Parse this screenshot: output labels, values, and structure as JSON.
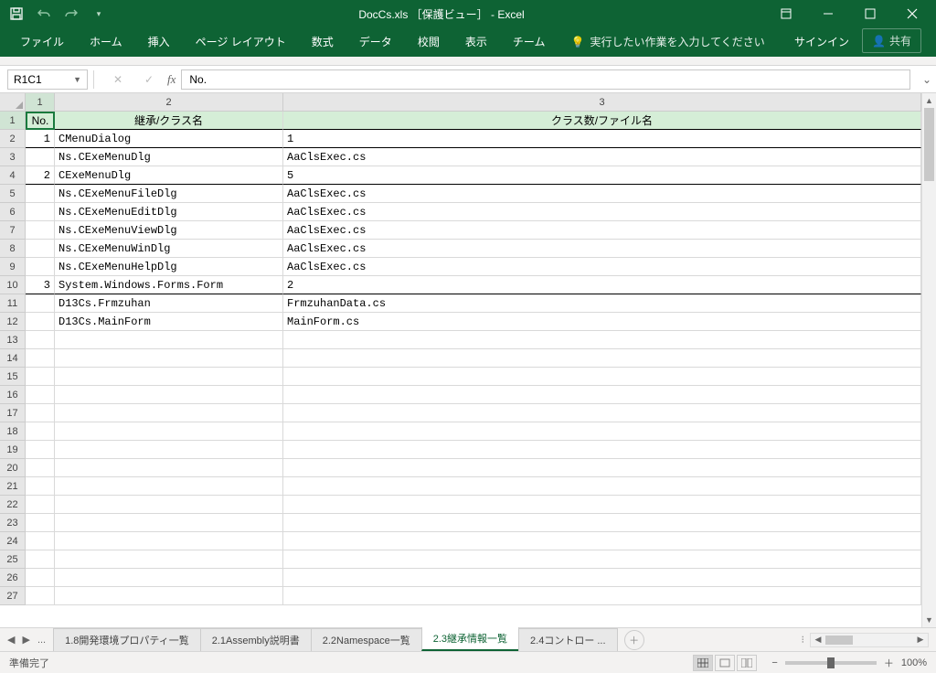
{
  "title": "DocCs.xls ［保護ビュー］ - Excel",
  "qat": {
    "save": "save-icon",
    "undo": "undo-icon",
    "redo": "redo-icon"
  },
  "win": {
    "restore": "restore-icon"
  },
  "tabs": [
    "ファイル",
    "ホーム",
    "挿入",
    "ページ レイアウト",
    "数式",
    "データ",
    "校閲",
    "表示",
    "チーム"
  ],
  "tellme": "実行したい作業を入力してください",
  "signin": "サインイン",
  "share": "共有",
  "namebox": "R1C1",
  "formula": "No.",
  "columns": [
    "1",
    "2",
    "3"
  ],
  "headers": {
    "no": "No.",
    "c2": "継承/クラス名",
    "c3": "クラス数/ファイル名"
  },
  "rows": [
    {
      "r": 2,
      "no": "1",
      "c2": "CMenuDialog",
      "c3": "1",
      "group": true
    },
    {
      "r": 3,
      "no": "",
      "c2": "Ns.CExeMenuDlg",
      "c3": "AaClsExec.cs"
    },
    {
      "r": 4,
      "no": "2",
      "c2": "CExeMenuDlg",
      "c3": "5",
      "group": true
    },
    {
      "r": 5,
      "no": "",
      "c2": "Ns.CExeMenuFileDlg",
      "c3": "AaClsExec.cs"
    },
    {
      "r": 6,
      "no": "",
      "c2": "Ns.CExeMenuEditDlg",
      "c3": "AaClsExec.cs"
    },
    {
      "r": 7,
      "no": "",
      "c2": "Ns.CExeMenuViewDlg",
      "c3": "AaClsExec.cs"
    },
    {
      "r": 8,
      "no": "",
      "c2": "Ns.CExeMenuWinDlg",
      "c3": "AaClsExec.cs"
    },
    {
      "r": 9,
      "no": "",
      "c2": "Ns.CExeMenuHelpDlg",
      "c3": "AaClsExec.cs"
    },
    {
      "r": 10,
      "no": "3",
      "c2": "System.Windows.Forms.Form",
      "c3": "2",
      "group": true
    },
    {
      "r": 11,
      "no": "",
      "c2": "D13Cs.Frmzuhan",
      "c3": "FrmzuhanData.cs"
    },
    {
      "r": 12,
      "no": "",
      "c2": "D13Cs.MainForm",
      "c3": "MainForm.cs"
    }
  ],
  "empty_rows": [
    13,
    14,
    15,
    16,
    17,
    18,
    19,
    20,
    21,
    22,
    23,
    24,
    25,
    26,
    27
  ],
  "sheets": {
    "items": [
      "1.8開発環境プロパティ一覧",
      "2.1Assembly説明書",
      "2.2Namespace一覧",
      "2.3継承情報一覧",
      "2.4コントロー ..."
    ],
    "active": 3,
    "ellipsis": "..."
  },
  "status": "準備完了",
  "zoom": "100%"
}
